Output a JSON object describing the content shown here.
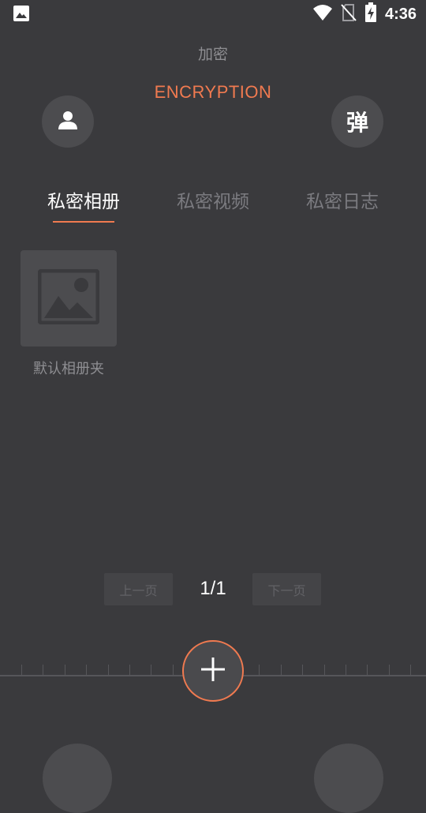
{
  "status_bar": {
    "time": "4:36",
    "icons": [
      "image-icon",
      "wifi-icon",
      "no-sim-icon",
      "battery-charging-icon"
    ]
  },
  "header": {
    "subtitle": "加密",
    "title": "ENCRYPTION",
    "left_button_icon": "user-icon",
    "right_button_label": "弹"
  },
  "tabs": [
    {
      "label": "私密相册",
      "active": true
    },
    {
      "label": "私密视频",
      "active": false
    },
    {
      "label": "私密日志",
      "active": false
    }
  ],
  "albums": [
    {
      "label": "默认相册夹",
      "icon": "image-placeholder-icon"
    }
  ],
  "pager": {
    "prev_label": "上一页",
    "page": "1/1",
    "next_label": "下一页"
  },
  "fab": {
    "icon": "plus-icon"
  },
  "colors": {
    "background": "#3a3a3d",
    "accent": "#f07a50",
    "surface": "#4c4c4f"
  }
}
